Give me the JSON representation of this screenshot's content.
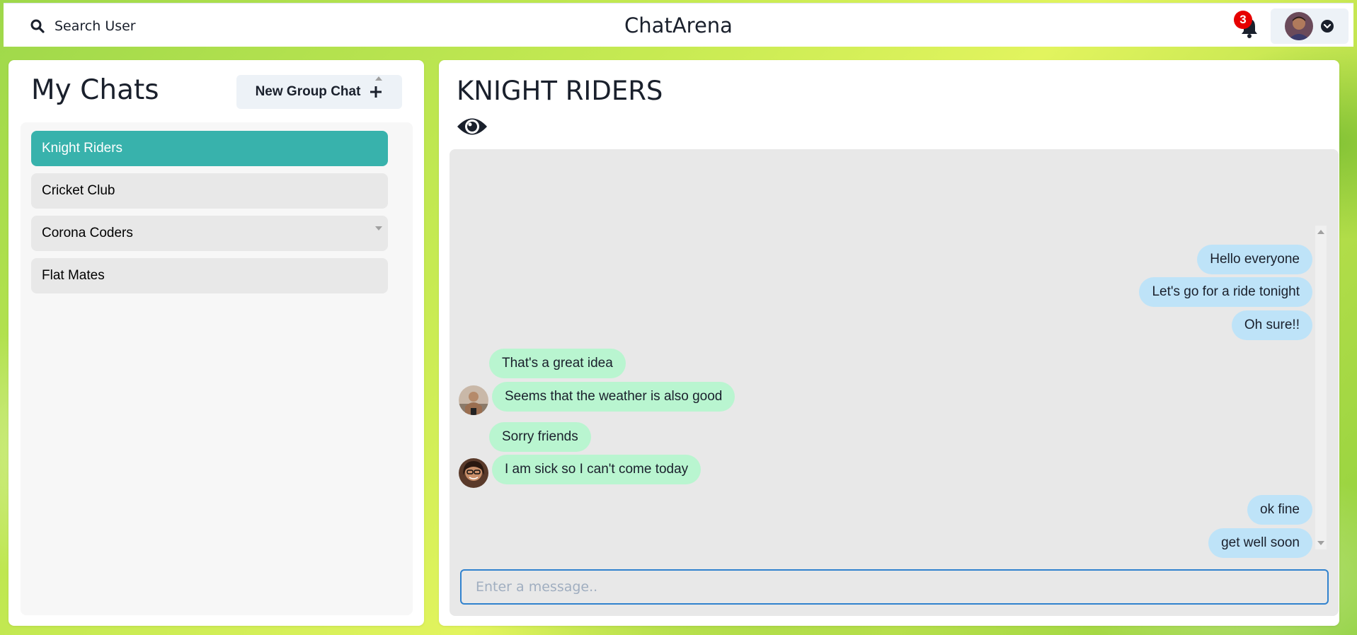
{
  "topbar": {
    "search_label": "Search User",
    "app_title": "ChatArena",
    "notification_count": "3",
    "icons": [
      "search-icon",
      "bell-icon",
      "avatar",
      "chevron-down-icon"
    ]
  },
  "sidebar": {
    "title": "My Chats",
    "new_group_label": "New Group Chat",
    "chats": [
      {
        "name": "Knight Riders",
        "active": true
      },
      {
        "name": "Cricket Club",
        "active": false
      },
      {
        "name": "Corona Coders",
        "active": false
      },
      {
        "name": "Flat Mates",
        "active": false
      }
    ]
  },
  "chat": {
    "title": "KNIGHT RIDERS",
    "messages": [
      {
        "text": "Hello everyone",
        "sender": "me"
      },
      {
        "text": "Let's go for a ride tonight",
        "sender": "me"
      },
      {
        "text": "Oh sure!!",
        "sender": "me"
      },
      {
        "text": "That's a great idea",
        "sender": "other"
      },
      {
        "text": "Seems that the weather is also good",
        "sender": "other"
      },
      {
        "text": "Sorry friends",
        "sender": "other"
      },
      {
        "text": "I am sick so I can't come today",
        "sender": "other"
      },
      {
        "text": "ok fine",
        "sender": "me"
      },
      {
        "text": "get well soon",
        "sender": "me"
      }
    ],
    "input_placeholder": "Enter a message.."
  },
  "colors": {
    "active_chat": "#38b2ac",
    "my_bubble": "#bee3f8",
    "other_bubble": "#b9f5d0",
    "badge": "#e60000",
    "input_border": "#3182ce"
  }
}
